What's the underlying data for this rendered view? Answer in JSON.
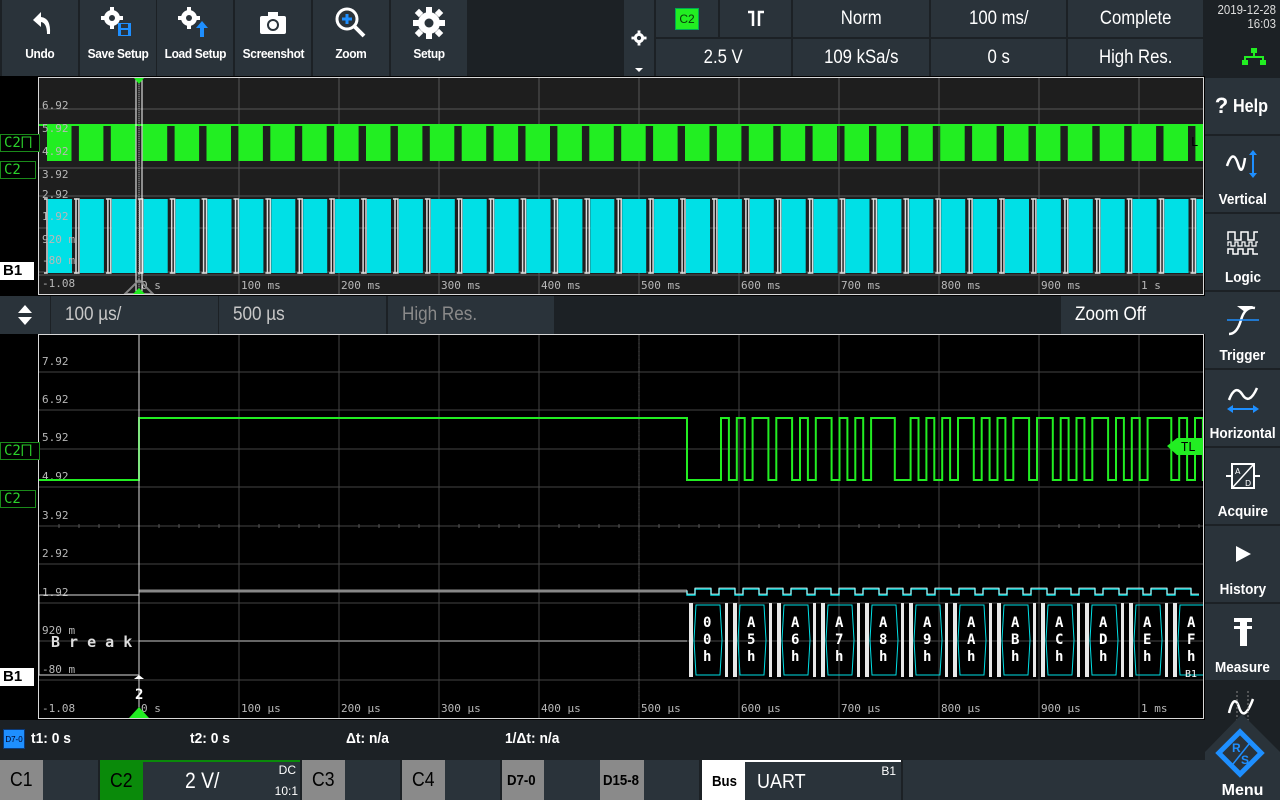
{
  "toolbar": {
    "buttons": [
      {
        "label": "Undo",
        "icon": "undo-icon"
      },
      {
        "label": "Save Setup",
        "icon": "save-setup-icon"
      },
      {
        "label": "Load Setup",
        "icon": "load-setup-icon"
      },
      {
        "label": "Screenshot",
        "icon": "camera-icon"
      },
      {
        "label": "Zoom",
        "icon": "zoom-in-icon"
      },
      {
        "label": "Setup",
        "icon": "gear-icon"
      }
    ]
  },
  "status": {
    "trigger_source": "C2",
    "trigger_slope": "⨅",
    "trigger_mode": "Norm",
    "timebase": "100 ms/",
    "acq_state": "Complete",
    "trigger_level": "2.5 V",
    "sample_rate": "109 kSa/s",
    "horiz_position": "0 s",
    "acq_mode": "High Res.",
    "date": "2019-12-28",
    "time": "16:03"
  },
  "sidebar": {
    "items": [
      {
        "label": "Help",
        "icon": "help-icon"
      },
      {
        "label": "Vertical",
        "icon": "vertical-icon"
      },
      {
        "label": "Logic",
        "icon": "logic-icon"
      },
      {
        "label": "Trigger",
        "icon": "trigger-icon"
      },
      {
        "label": "Horizontal",
        "icon": "horizontal-icon"
      },
      {
        "label": "Acquire",
        "icon": "acquire-icon"
      },
      {
        "label": "History",
        "icon": "play-icon"
      },
      {
        "label": "Measure",
        "icon": "measure-icon"
      }
    ],
    "menu_label": "Menu"
  },
  "overview": {
    "y_labels": [
      "6.92",
      "5.92",
      "4.92",
      "3.92",
      "2.92",
      "1.92",
      "920 m",
      "-80 m",
      "-1.08"
    ],
    "x_labels": [
      "0 s",
      "100 ms",
      "200 ms",
      "300 ms",
      "400 ms",
      "500 ms",
      "600 ms",
      "700 ms",
      "800 ms",
      "900 ms",
      "1 s"
    ],
    "tags": {
      "c2_trig": "C2⨅",
      "c2": "C2",
      "b1": "B1"
    },
    "level_marker": "L"
  },
  "zoombar": {
    "timebase": "100 µs/",
    "position": "500 µs",
    "mode": "High Res.",
    "zoom_state": "Zoom Off"
  },
  "detail": {
    "y_labels": [
      "7.92",
      "6.92",
      "5.92",
      "4.92",
      "3.92",
      "2.92",
      "1.92",
      "920 m",
      "-80 m",
      "-1.08"
    ],
    "x_labels": [
      "0 s",
      "100 µs",
      "200 µs",
      "300 µs",
      "400 µs",
      "500 µs",
      "600 µs",
      "700 µs",
      "800 µs",
      "900 µs",
      "1 ms"
    ],
    "tags": {
      "c2_trig": "C2⨅",
      "c2": "C2",
      "b1": "B1"
    },
    "trigger_level_marker": "TL",
    "break_label": "Break",
    "cursor_label": "2",
    "bus_frames": [
      "00h",
      "A5h",
      "A6h",
      "A7h",
      "A8h",
      "A9h",
      "AAh",
      "ABh",
      "ACh",
      "ADh",
      "AEh",
      "AFh"
    ],
    "bus_tag": "B1"
  },
  "cursors": {
    "source": "D7-0",
    "t1": "t1: 0 s",
    "t2": "t2: 0 s",
    "dt": "Δt: n/a",
    "inv_dt": "1/Δt: n/a"
  },
  "channels": {
    "c1": "C1",
    "c2": "C2",
    "c2_scale": "2 V/",
    "c2_coupling": "DC",
    "c2_probe": "10:1",
    "c3": "C3",
    "c4": "C4",
    "d70": "D7-0",
    "d158": "D15-8",
    "bus": "Bus",
    "bus_protocol": "UART",
    "bus_id": "B1"
  },
  "colors": {
    "c2": "#22ee22",
    "bus": "#00e0e6",
    "accent_blue": "#1e90ff"
  }
}
